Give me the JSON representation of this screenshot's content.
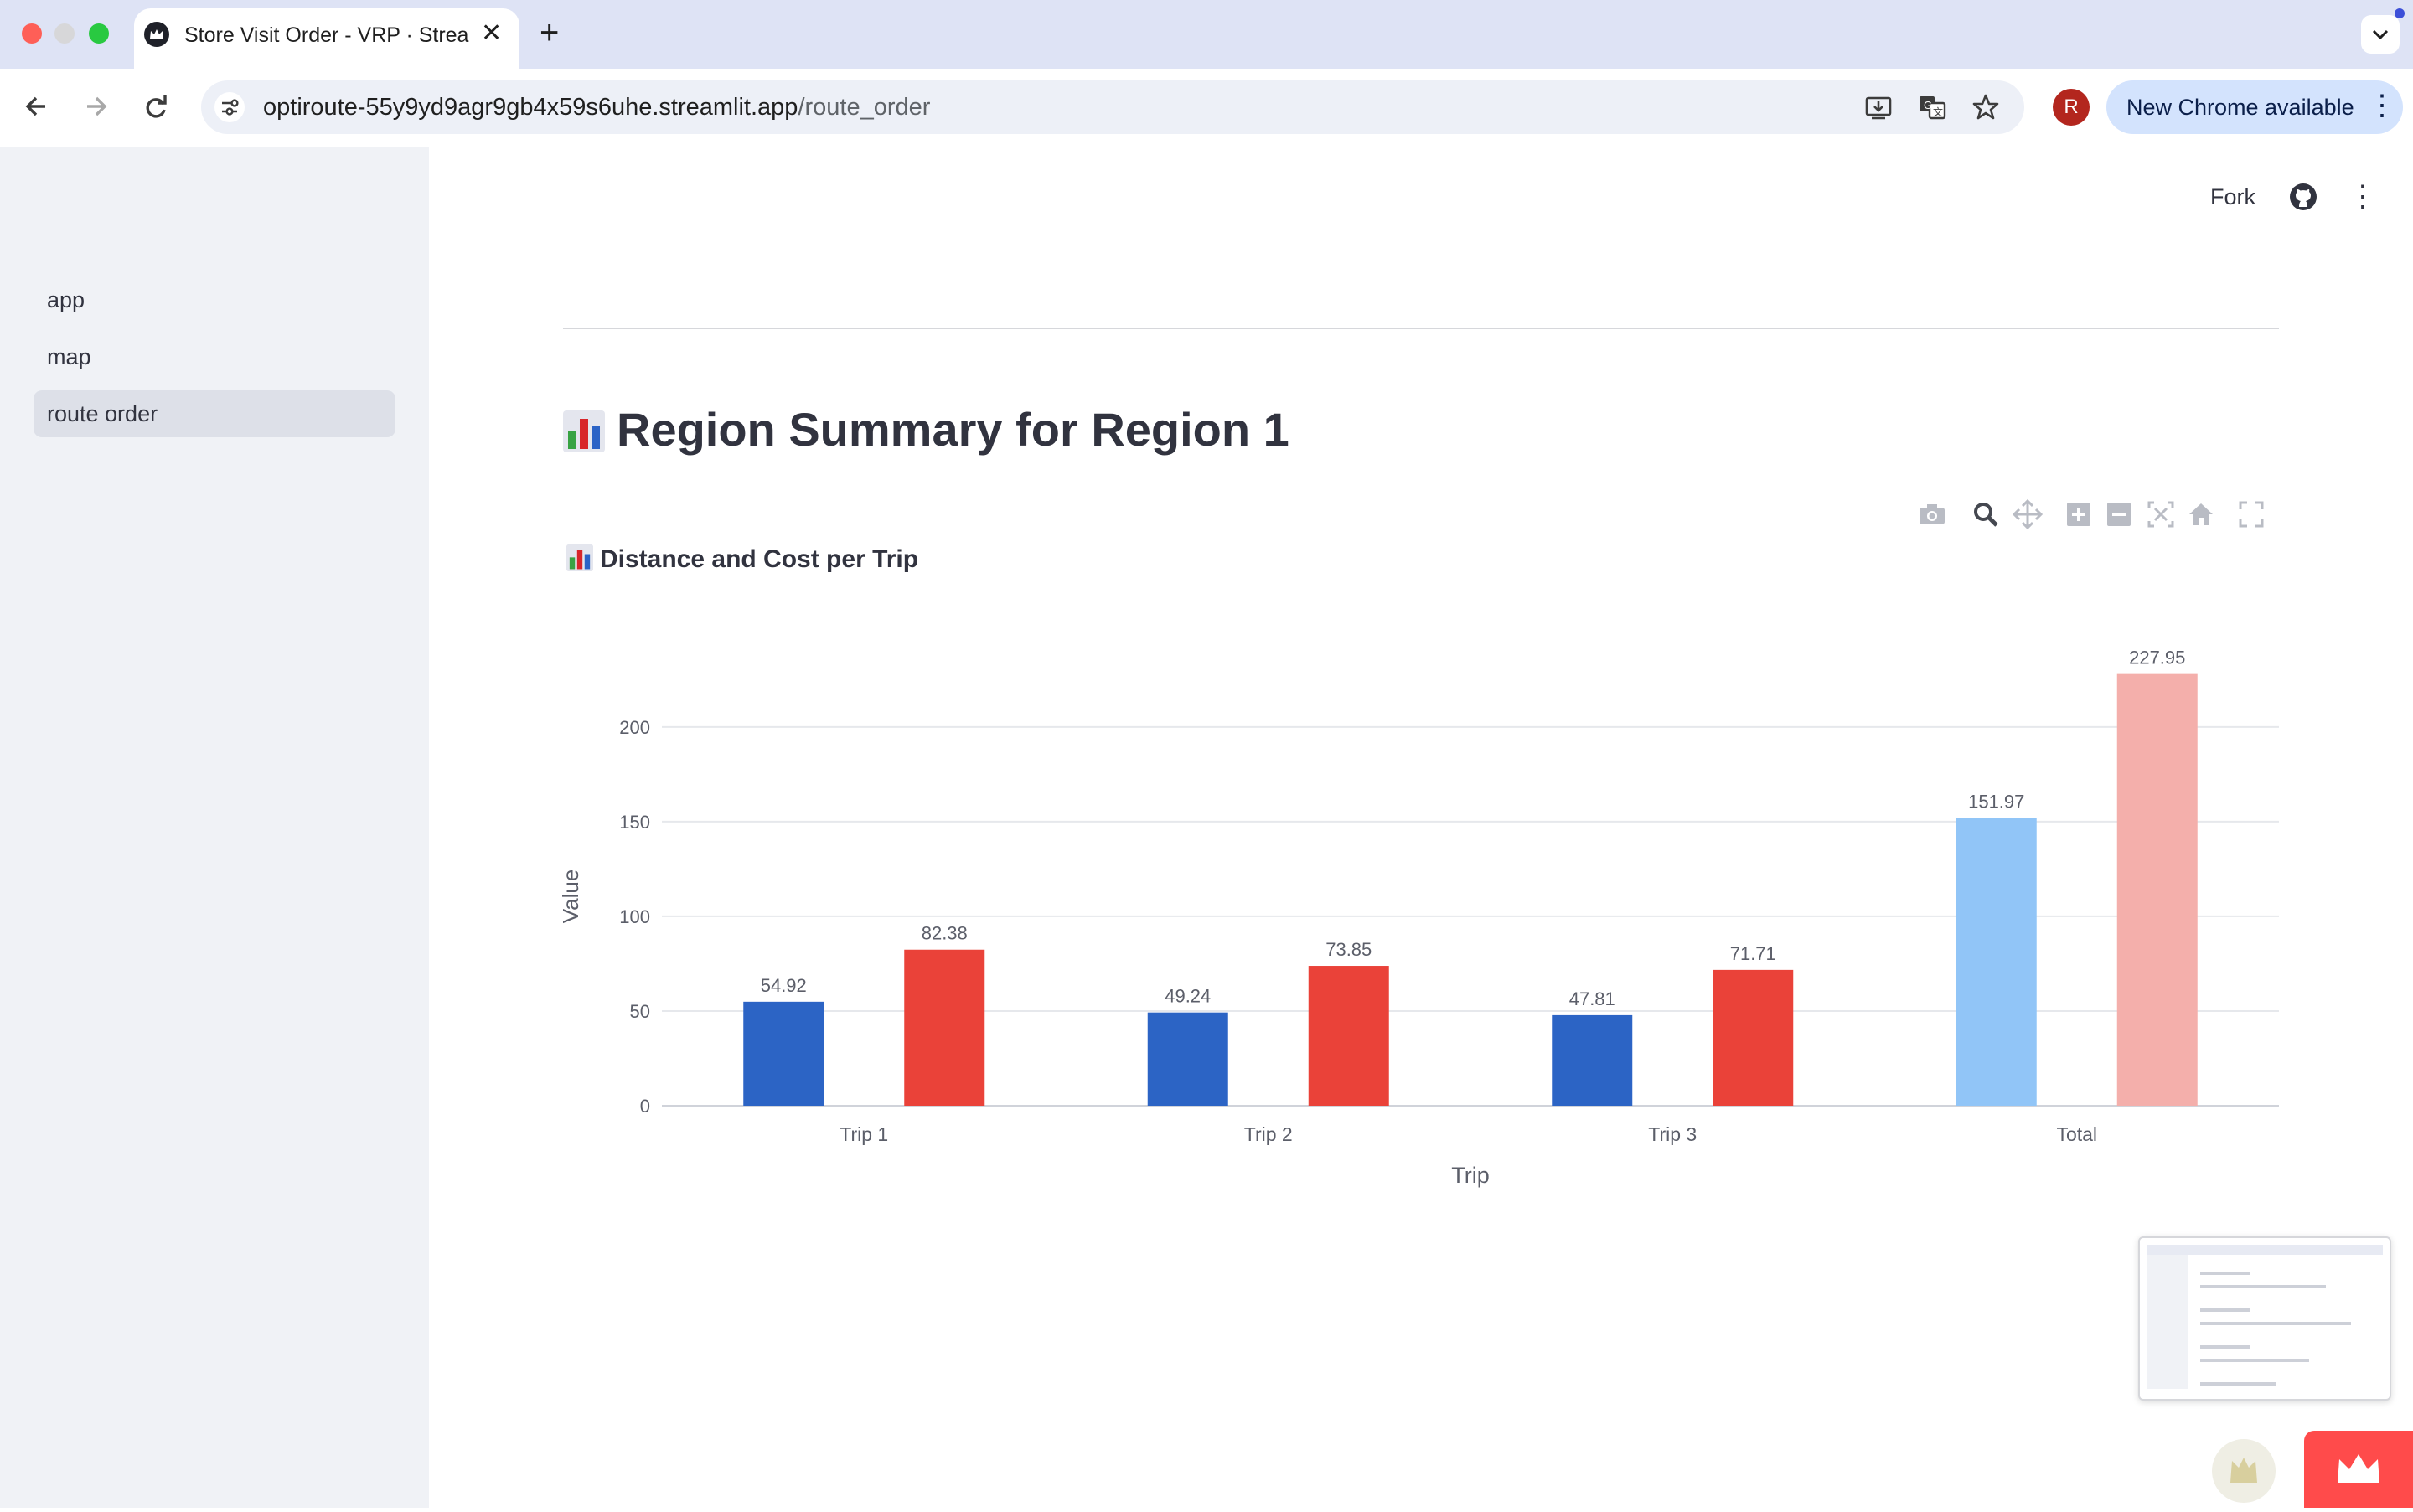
{
  "browser": {
    "tab_title": "Store Visit Order - VRP · Streamlit",
    "url_host": "optiroute-55y9yd9agr9gb4x59s6uhe.streamlit.app",
    "url_path": "/route_order",
    "update_label": "New Chrome available",
    "profile_initial": "R",
    "icons": {
      "back": "arrow-left-icon",
      "forward": "arrow-right-icon",
      "reload": "reload-icon",
      "site_info": "tune-icon",
      "install": "install-icon",
      "translate": "translate-icon",
      "bookmark": "star-icon",
      "menu": "kebab-icon"
    }
  },
  "sidebar": {
    "items": [
      {
        "label": "app",
        "active": false
      },
      {
        "label": "map",
        "active": false
      },
      {
        "label": "route order",
        "active": true
      }
    ]
  },
  "header": {
    "fork_label": "Fork"
  },
  "main": {
    "title": "Region Summary for Region 1",
    "chart_heading": "Distance and Cost per Trip"
  },
  "colors": {
    "distance": "#2c64c5",
    "cost": "#ea4239",
    "distance_total": "#91c5f7",
    "cost_total": "#f4afab",
    "accent": "#ff4b4b"
  },
  "chart_data": {
    "type": "bar",
    "categories": [
      "Trip 1",
      "Trip 2",
      "Trip 3",
      "Total"
    ],
    "series": [
      {
        "values": [
          54.92,
          49.24,
          47.81,
          151.97
        ]
      },
      {
        "values": [
          82.38,
          73.85,
          71.71,
          227.95
        ]
      }
    ],
    "data_labels": [
      [
        "54.92",
        "49.24",
        "47.81",
        "151.97"
      ],
      [
        "82.38",
        "73.85",
        "71.71",
        "227.95"
      ]
    ],
    "xlabel": "Trip",
    "ylabel": "Value",
    "ylim": [
      0,
      230
    ],
    "yticks": [
      0,
      50,
      100,
      150,
      200
    ],
    "grid": true,
    "legend": "none"
  }
}
